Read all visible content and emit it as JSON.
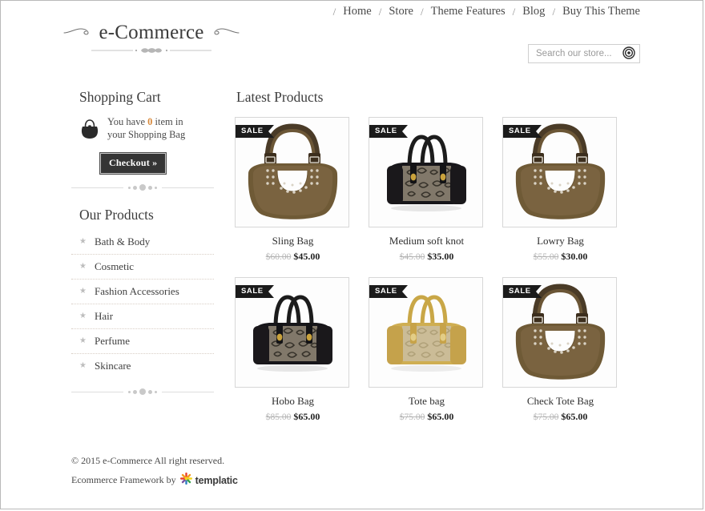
{
  "site": {
    "logo_text": "e-Commerce"
  },
  "nav": {
    "separator": "/",
    "items": [
      {
        "label": "Home"
      },
      {
        "label": "Store"
      },
      {
        "label": "Theme Features"
      },
      {
        "label": "Blog"
      },
      {
        "label": "Buy This Theme"
      }
    ]
  },
  "search": {
    "placeholder": "Search our store...",
    "value": "",
    "icon": "target-search-icon"
  },
  "cart": {
    "title": "Shopping Cart",
    "message_before": "You have ",
    "count": "0",
    "message_after": " item in your Shopping Bag",
    "checkout_label": "Checkout »",
    "count_color": "#d8893b",
    "icon": "handbag-icon"
  },
  "categories": {
    "title": "Our Products",
    "bullet": "★",
    "items": [
      {
        "label": "Bath & Body"
      },
      {
        "label": "Cosmetic"
      },
      {
        "label": "Fashion Accessories"
      },
      {
        "label": "Hair"
      },
      {
        "label": "Perfume"
      },
      {
        "label": "Skincare"
      }
    ]
  },
  "main": {
    "title": "Latest Products",
    "sale_label": "SALE",
    "products": [
      {
        "name": "Sling Bag",
        "old_price": "$60.00",
        "new_price": "$45.00",
        "on_sale": true,
        "image": "brown-studded-hobo-bag"
      },
      {
        "name": "Medium soft knot",
        "old_price": "$45.00",
        "new_price": "$35.00",
        "on_sale": true,
        "image": "black-monogram-satchel"
      },
      {
        "name": "Lowry Bag",
        "old_price": "$55.00",
        "new_price": "$30.00",
        "on_sale": true,
        "image": "brown-studded-hobo-bag"
      },
      {
        "name": "Hobo Bag",
        "old_price": "$85.00",
        "new_price": "$65.00",
        "on_sale": true,
        "image": "black-monogram-satchel"
      },
      {
        "name": "Tote bag",
        "old_price": "$75.00",
        "new_price": "$65.00",
        "on_sale": true,
        "image": "gold-monogram-satchel"
      },
      {
        "name": "Check Tote Bag",
        "old_price": "$75.00",
        "new_price": "$65.00",
        "on_sale": true,
        "image": "brown-studded-hobo-bag"
      }
    ]
  },
  "footer": {
    "copyright": "© 2015 e-Commerce All right reserved.",
    "credit_prefix": "Ecommerce Framework by",
    "credit_brand": "templatic",
    "credit_icon": "templatic-starburst-logo"
  }
}
